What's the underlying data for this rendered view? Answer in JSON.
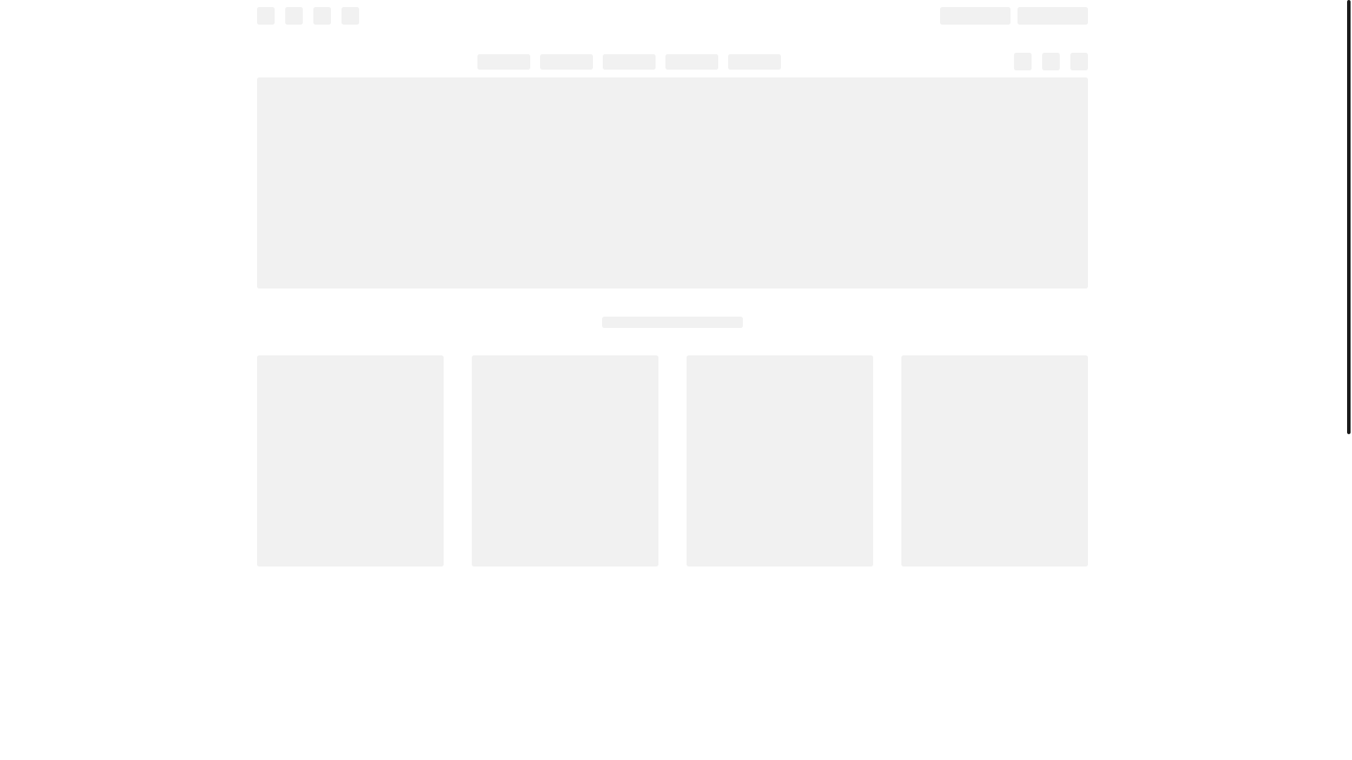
{
  "page": {
    "state": "loading-skeleton"
  },
  "colors": {
    "background": "#ffffff",
    "placeholder": "#f1f1f1",
    "scrollbar": "#1b1b1b"
  },
  "top_bar": {
    "icon_placeholders": [
      "icon-placeholder",
      "icon-placeholder",
      "icon-placeholder",
      "icon-placeholder"
    ],
    "action_placeholders": [
      "button-placeholder",
      "button-placeholder"
    ]
  },
  "nav": {
    "tab_placeholders": [
      "tab-placeholder",
      "tab-placeholder",
      "tab-placeholder",
      "tab-placeholder",
      "tab-placeholder"
    ],
    "icon_placeholders": [
      "icon-placeholder",
      "icon-placeholder",
      "icon-placeholder"
    ]
  },
  "content": {
    "hero": "banner-placeholder",
    "section_heading": "heading-placeholder",
    "cards": [
      "card-placeholder",
      "card-placeholder",
      "card-placeholder",
      "card-placeholder"
    ]
  }
}
